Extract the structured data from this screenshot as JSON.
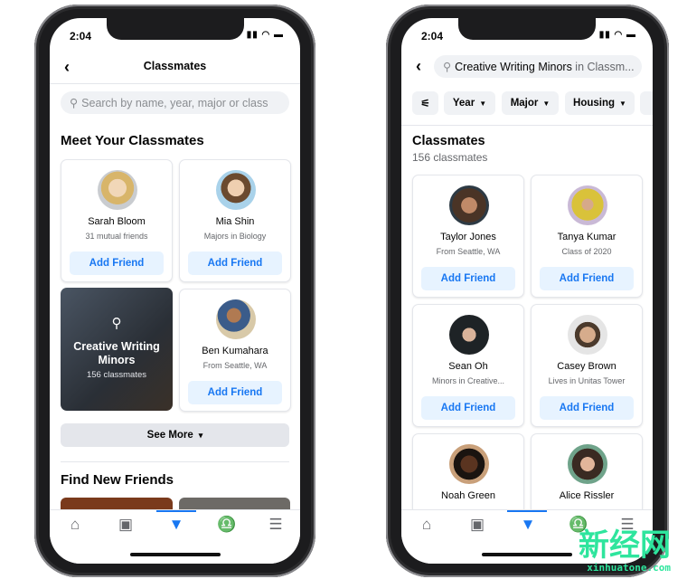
{
  "left": {
    "status_time": "2:04",
    "title": "Classmates",
    "search_placeholder": "Search by name, year, major or class",
    "section_title": "Meet Your Classmates",
    "cards": [
      {
        "name": "Sarah Bloom",
        "sub": "31 mutual friends",
        "button": "Add Friend"
      },
      {
        "name": "Mia Shin",
        "sub": "Majors in Biology",
        "button": "Add Friend"
      },
      {
        "name": "Ben Kumahara",
        "sub": "From Seattle, WA",
        "button": "Add Friend"
      }
    ],
    "group_card": {
      "title": "Creative Writing Minors",
      "count": "156 classmates"
    },
    "see_more": "See More",
    "section2_title": "Find New Friends"
  },
  "right": {
    "status_time": "2:04",
    "search_query": "Creative Writing Minors",
    "search_suffix": " in Classm...",
    "chips": [
      "Year",
      "Major",
      "Housing"
    ],
    "title": "Classmates",
    "count": "156 classmates",
    "cards": [
      {
        "name": "Taylor Jones",
        "sub": "From Seattle, WA",
        "button": "Add Friend"
      },
      {
        "name": "Tanya Kumar",
        "sub": "Class of 2020",
        "button": "Add Friend"
      },
      {
        "name": "Sean Oh",
        "sub": "Minors in Creative...",
        "button": "Add Friend"
      },
      {
        "name": "Casey Brown",
        "sub": "Lives in Unitas Tower",
        "button": "Add Friend"
      },
      {
        "name": "Noah Green",
        "sub": "",
        "button": ""
      },
      {
        "name": "Alice Rissler",
        "sub": "",
        "button": ""
      }
    ]
  },
  "tabs": [
    "home-icon",
    "watch-icon",
    "groups-icon",
    "bell-icon",
    "menu-icon"
  ],
  "accent": "#1877f2",
  "watermark": {
    "cn": "新经网",
    "url": "xinhuatone.com"
  }
}
